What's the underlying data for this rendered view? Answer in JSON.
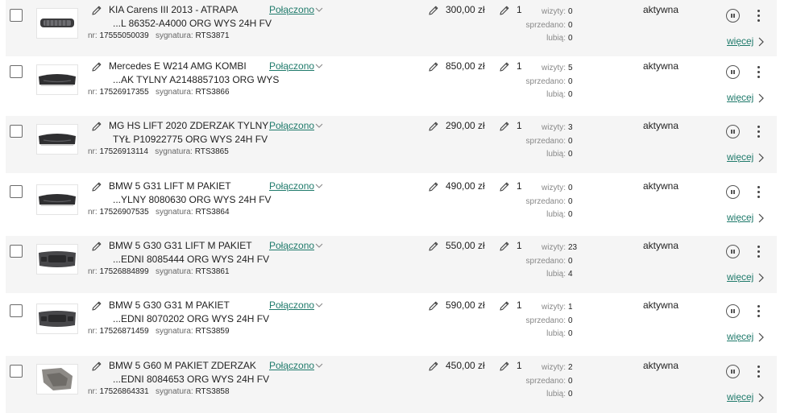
{
  "colors": {
    "link": "#1f7a6b",
    "row_alt": "#f5f5f5"
  },
  "labels": {
    "nr": "nr:",
    "sygnatura": "sygnatura:",
    "wizyty": "wizyty:",
    "sprzedano": "sprzedano:",
    "lubia": "lubią:",
    "more": "więcej"
  },
  "listings": [
    {
      "title_line1": "KIA Carens III 2013 - ATRAPA",
      "title_line2": "...L 86352-A4000 ORG WYS 24H FV",
      "nr": "17555050039",
      "sygnatura": "RTS3871",
      "status": "Połączono",
      "price": "300,00 zł",
      "qty": "1",
      "visits": "0",
      "sold": "0",
      "likes": "0",
      "state": "aktywna",
      "thumb": "grille"
    },
    {
      "title_line1": "Mercedes E W214 AMG KOMBI",
      "title_line2": "...AK TYLNY A2148857103 ORG WYS",
      "nr": "17526917355",
      "sygnatura": "RTS3866",
      "status": "Połączono",
      "price": "850,00 zł",
      "qty": "1",
      "visits": "5",
      "sold": "0",
      "likes": "0",
      "state": "aktywna",
      "thumb": "rear-bumper"
    },
    {
      "title_line1": "MG HS LIFT 2020 ZDERZAK TYLNY",
      "title_line2": "TYŁ P10922775 ORG WYS 24H FV",
      "nr": "17526913114",
      "sygnatura": "RTS3865",
      "status": "Połączono",
      "price": "290,00 zł",
      "qty": "1",
      "visits": "3",
      "sold": "0",
      "likes": "0",
      "state": "aktywna",
      "thumb": "rear-bumper"
    },
    {
      "title_line1": "BMW 5 G31 LIFT M PAKIET",
      "title_line2": "...YLNY 8080630 ORG WYS 24H FV",
      "nr": "17526907535",
      "sygnatura": "RTS3864",
      "status": "Połączono",
      "price": "490,00 zł",
      "qty": "1",
      "visits": "0",
      "sold": "0",
      "likes": "0",
      "state": "aktywna",
      "thumb": "rear-bumper"
    },
    {
      "title_line1": "BMW 5 G30 G31 LIFT M PAKIET",
      "title_line2": "...EDNI 8085444 ORG WYS 24H FV",
      "nr": "17526884899",
      "sygnatura": "RTS3861",
      "status": "Połączono",
      "price": "550,00 zł",
      "qty": "1",
      "visits": "23",
      "sold": "0",
      "likes": "4",
      "state": "aktywna",
      "thumb": "front-bumper"
    },
    {
      "title_line1": "BMW 5 G30 G31 M PAKIET",
      "title_line2": "...EDNI 8070202 ORG WYS 24H FV",
      "nr": "17526871459",
      "sygnatura": "RTS3859",
      "status": "Połączono",
      "price": "590,00 zł",
      "qty": "1",
      "visits": "1",
      "sold": "0",
      "likes": "0",
      "state": "aktywna",
      "thumb": "front-bumper"
    },
    {
      "title_line1": "BMW 5 G60 M PAKIET ZDERZAK",
      "title_line2": "...EDNI 8084653 ORG WYS 24H FV",
      "nr": "17526864331",
      "sygnatura": "RTS3858",
      "status": "Połączono",
      "price": "450,00 zł",
      "qty": "1",
      "visits": "2",
      "sold": "0",
      "likes": "0",
      "state": "aktywna",
      "thumb": "bumper-part"
    }
  ]
}
